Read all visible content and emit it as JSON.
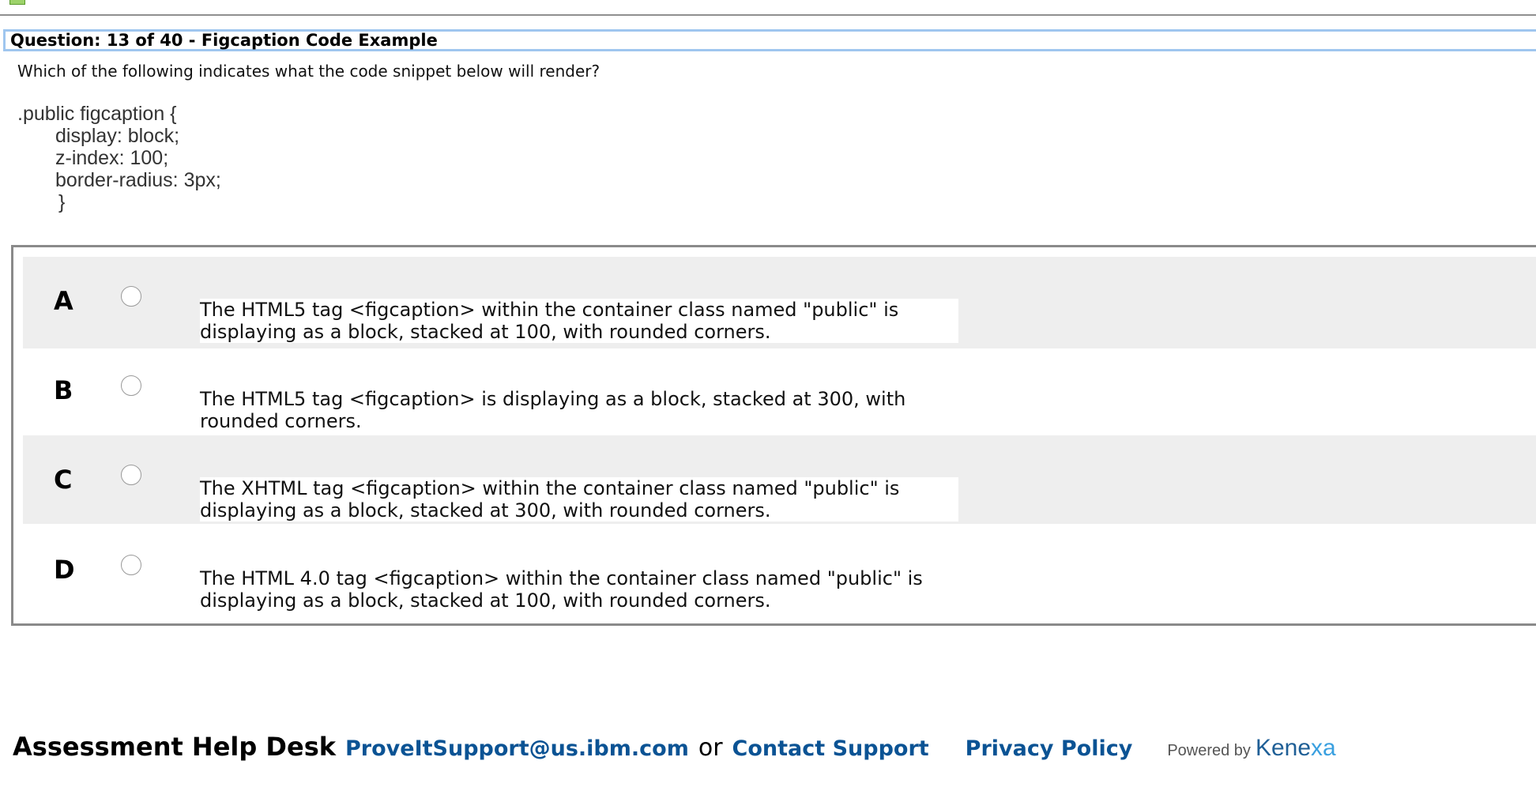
{
  "question": {
    "header": "Question: 13 of 40  -  Figcaption Code Example",
    "prompt": "Which of the following indicates what the code snippet below will render?",
    "code": [
      ".public figcaption {",
      "display: block;",
      "z-index: 100;",
      "border-radius: 3px;",
      "}"
    ]
  },
  "options": [
    {
      "letter": "A",
      "text": "The HTML5 tag <figcaption> within the container class named \"public\" is displaying as a block, stacked at 100, with rounded corners."
    },
    {
      "letter": "B",
      "text": "The HTML5 tag <figcaption> is displaying as a block, stacked at 300, with rounded corners."
    },
    {
      "letter": "C",
      "text": "The XHTML tag <figcaption> within the container class named \"public\" is displaying as a block, stacked at 300, with rounded corners."
    },
    {
      "letter": "D",
      "text": "The HTML 4.0 tag <figcaption> within the container class named \"public\" is displaying as a block, stacked at 100, with rounded corners."
    }
  ],
  "footer": {
    "help_desk": "Assessment Help Desk",
    "email": "ProveItSupport@us.ibm.com",
    "or": "or",
    "contact": "Contact Support",
    "privacy": "Privacy Policy",
    "powered_by": "Powered by",
    "brand_prefix": "Kene",
    "brand_suffix": "xa"
  },
  "colors": {
    "header_border": "#9fc6ef",
    "option_shade": "#eeeeee",
    "link": "#0b5394"
  }
}
